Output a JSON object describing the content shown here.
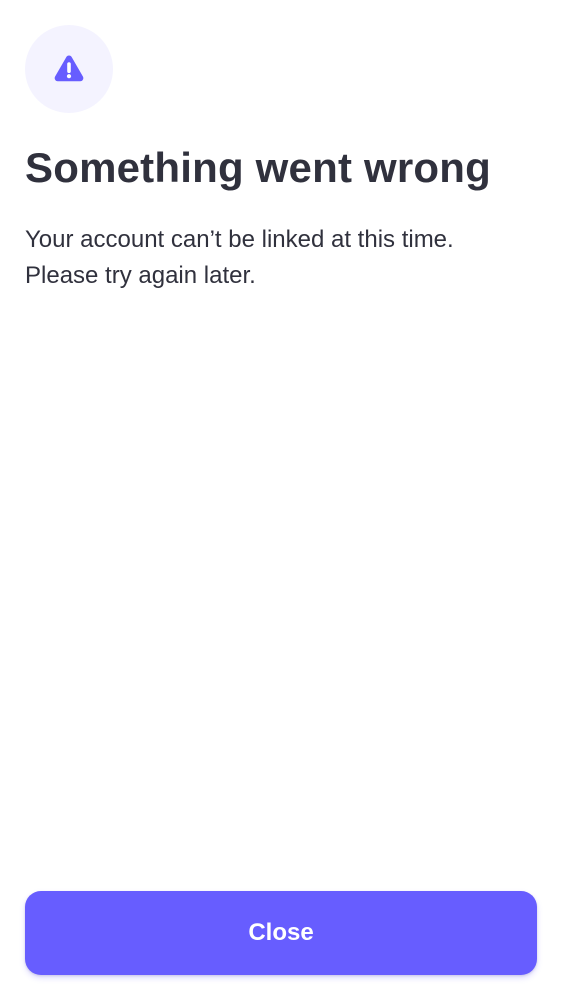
{
  "icon": {
    "name": "warning-triangle-icon",
    "color": "#675dff",
    "background": "#f4f3ff"
  },
  "title": "Something went wrong",
  "message": {
    "line1": "Your account can’t be linked at this time.",
    "line2": "Please try again later."
  },
  "actions": {
    "close_label": "Close",
    "button_color": "#675dff"
  }
}
